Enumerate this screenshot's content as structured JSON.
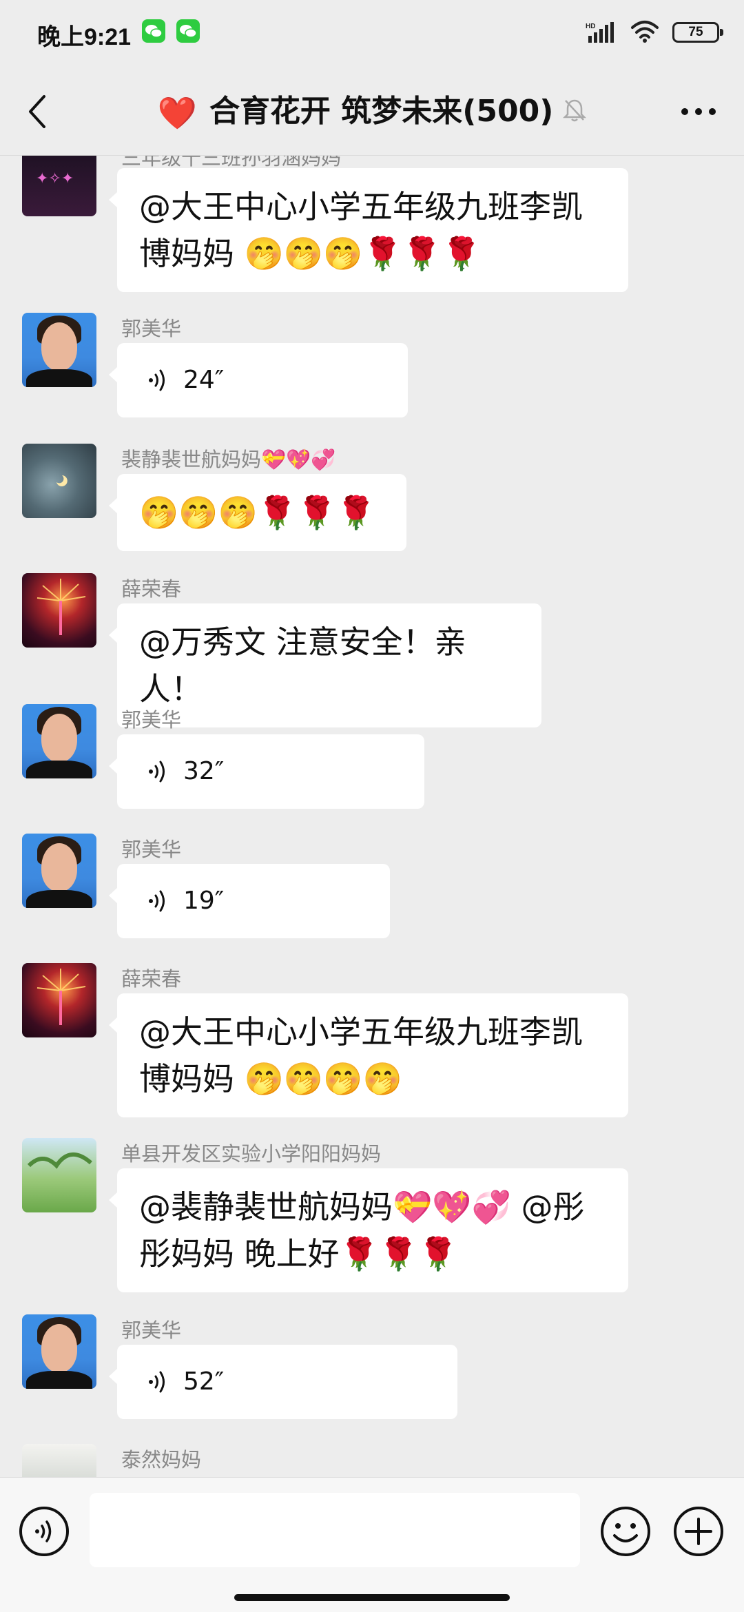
{
  "status_bar": {
    "time": "晚上9:21",
    "network_badge": "HD",
    "battery": "75"
  },
  "header": {
    "heart": "❤️",
    "title": "合育花开 筑梦未来(500)"
  },
  "messages": [
    {
      "sender": "三年级十三班孙羽涵妈妈",
      "type": "text",
      "text": "@大王中心小学五年级九班李凯博妈妈 🤭🤭🤭🌹🌹🌹"
    },
    {
      "sender": "郭美华",
      "type": "voice",
      "duration": "24″"
    },
    {
      "sender": "裴静裴世航妈妈💝💖💞",
      "type": "text",
      "text": "🤭🤭🤭🌹🌹🌹"
    },
    {
      "sender": "薛荣春",
      "type": "text",
      "text": "@万秀文  注意安全！亲人！"
    },
    {
      "sender": "郭美华",
      "type": "voice",
      "duration": "32″"
    },
    {
      "sender": "郭美华",
      "type": "voice",
      "duration": "19″"
    },
    {
      "sender": "薛荣春",
      "type": "text",
      "text": "@大王中心小学五年级九班李凯博妈妈 🤭🤭🤭🤭"
    },
    {
      "sender": "单县开发区实验小学阳阳妈妈",
      "type": "text",
      "text": "@裴静裴世航妈妈💝💖💞 @彤彤妈妈  晚上好🌹🌹🌹"
    },
    {
      "sender": "郭美华",
      "type": "voice",
      "duration": "52″"
    },
    {
      "sender": "泰然妈妈",
      "type": "text",
      "text": ""
    }
  ],
  "input": {
    "value": ""
  },
  "icons": {
    "back": "chevron-left-icon",
    "mute": "bell-off-icon",
    "more": "ellipsis-icon",
    "voice_toggle": "voice-icon",
    "emoji": "smiley-icon",
    "plus": "plus-circle-icon"
  }
}
